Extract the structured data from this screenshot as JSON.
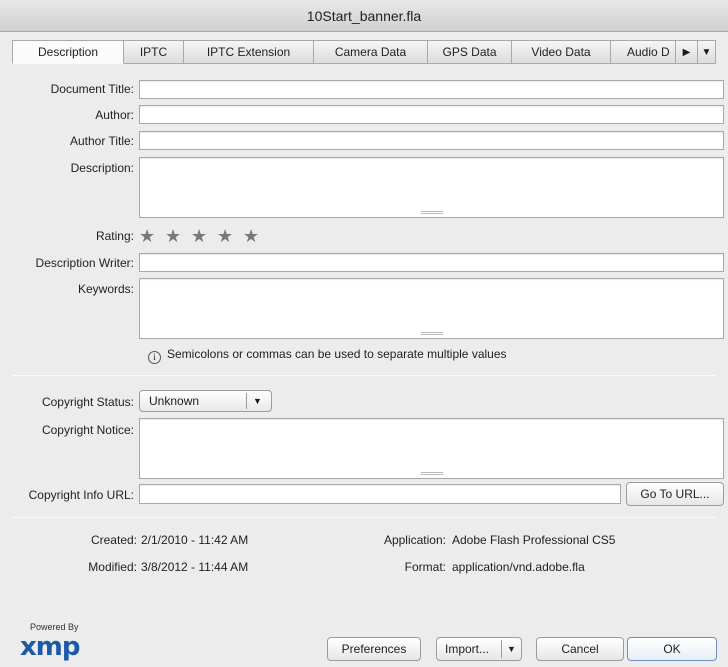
{
  "window": {
    "title": "10Start_banner.fla"
  },
  "tabs": [
    {
      "label": "Description",
      "active": true
    },
    {
      "label": "IPTC"
    },
    {
      "label": "IPTC Extension"
    },
    {
      "label": "Camera Data"
    },
    {
      "label": "GPS Data"
    },
    {
      "label": "Video Data"
    },
    {
      "label": "Audio D"
    }
  ],
  "tab_icons": {
    "next": "right-triangle-icon",
    "menu": "down-triangle-icon"
  },
  "form": {
    "document_title": {
      "label": "Document Title:",
      "value": ""
    },
    "author": {
      "label": "Author:",
      "value": ""
    },
    "author_title": {
      "label": "Author Title:",
      "value": ""
    },
    "description": {
      "label": "Description:",
      "value": ""
    },
    "rating": {
      "label": "Rating:",
      "stars": 0,
      "max": 5
    },
    "description_writer": {
      "label": "Description Writer:",
      "value": ""
    },
    "keywords": {
      "label": "Keywords:",
      "value": ""
    },
    "keywords_hint": "Semicolons or commas can be used to separate multiple values",
    "copyright_status": {
      "label": "Copyright Status:",
      "value": "Unknown"
    },
    "copyright_notice": {
      "label": "Copyright Notice:",
      "value": ""
    },
    "copyright_url": {
      "label": "Copyright Info URL:",
      "value": "",
      "button": "Go To URL..."
    }
  },
  "meta": {
    "created_label": "Created:",
    "created_value": "2/1/2010 - 11:42 AM",
    "modified_label": "Modified:",
    "modified_value": "3/8/2012 - 11:44 AM",
    "application_label": "Application:",
    "application_value": "Adobe Flash Professional CS5",
    "format_label": "Format:",
    "format_value": "application/vnd.adobe.fla"
  },
  "footer": {
    "powered_by": "Powered By",
    "xmp": "xmp",
    "preferences": "Preferences",
    "import": "Import...",
    "cancel": "Cancel",
    "ok": "OK"
  },
  "colors": {
    "accent": "#1d5aa6",
    "star": "#7a7a7a"
  }
}
